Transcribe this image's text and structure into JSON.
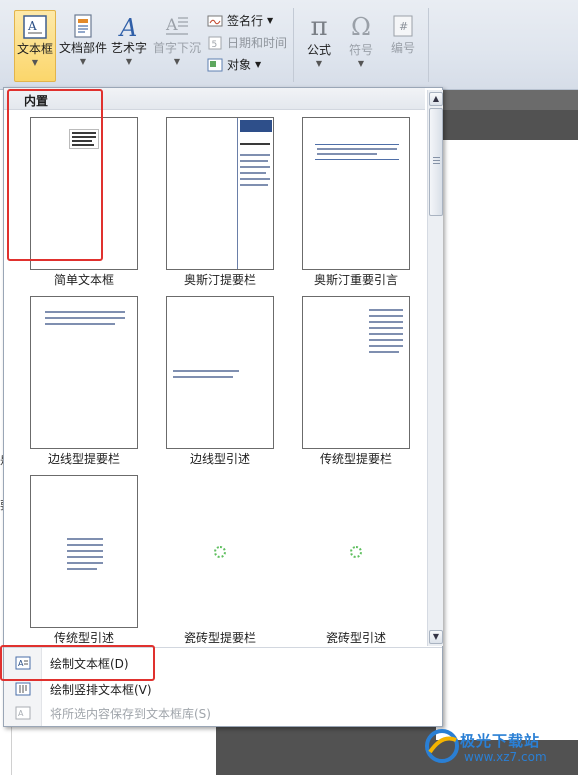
{
  "ribbon": {
    "textbox": "文本框",
    "quick_parts": "文档部件",
    "wordart": "艺术字",
    "dropcap": "首字下沉",
    "signature_line": "签名行",
    "date_time": "日期和时间",
    "object": "对象",
    "equation": "公式",
    "symbol": "符号",
    "number": "编号"
  },
  "gallery": {
    "category": "内置",
    "items": [
      {
        "label": "简单文本框"
      },
      {
        "label": "奥斯汀提要栏"
      },
      {
        "label": "奥斯汀重要引言"
      },
      {
        "label": "边线型提要栏"
      },
      {
        "label": "边线型引述"
      },
      {
        "label": "传统型提要栏"
      },
      {
        "label": "传统型引述"
      },
      {
        "label": "瓷砖型提要栏"
      },
      {
        "label": "瓷砖型引述"
      }
    ]
  },
  "menu": {
    "draw_textbox": "绘制文本框(D)",
    "draw_vertical_textbox": "绘制竖排文本框(V)",
    "save_selection": "将所选内容保存到文本框库(S)"
  },
  "document": {
    "mark1": "是",
    "mark2": "要"
  },
  "watermark": {
    "brand": "极光下载站",
    "url": "www.xz7.com"
  },
  "colors": {
    "highlight": "#e0312e",
    "accent": "#2a7fd4"
  }
}
